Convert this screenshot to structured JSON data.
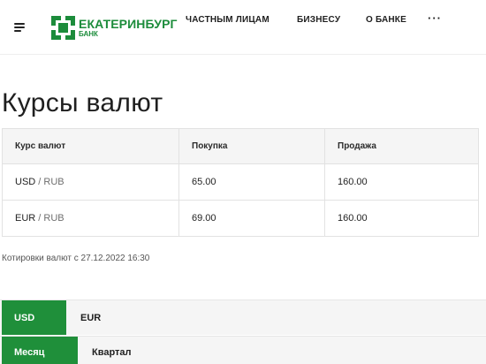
{
  "header": {
    "logo": {
      "name": "ЕКАТЕРИНБУРГ",
      "sub": "БАНК"
    },
    "nav": [
      "ЧАСТНЫМ ЛИЦАМ",
      "БИЗНЕСУ",
      "О БАНКЕ"
    ],
    "more": "···"
  },
  "page": {
    "title": "Курсы валют"
  },
  "table": {
    "headers": [
      "Курс валют",
      "Покупка",
      "Продажа"
    ],
    "rows": [
      {
        "currency": "USD",
        "base": "RUB",
        "buy": "65.00",
        "sell": "160.00"
      },
      {
        "currency": "EUR",
        "base": "RUB",
        "buy": "69.00",
        "sell": "160.00"
      }
    ]
  },
  "quote_note": "Котировки валют с 27.12.2022 16:30",
  "currency_switch": {
    "options": [
      "USD",
      "EUR"
    ],
    "selected": "USD"
  },
  "period_switch": {
    "options": [
      "Месяц",
      "Квартал"
    ],
    "selected": "Месяц"
  },
  "colors": {
    "brand": "#1c8c3b",
    "active": "#1f8f3a"
  }
}
